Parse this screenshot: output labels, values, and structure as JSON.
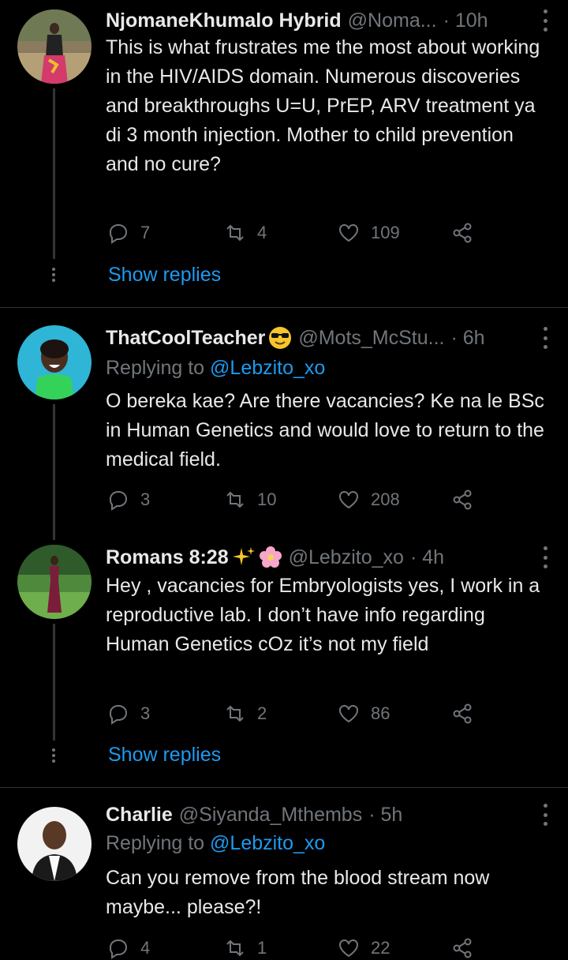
{
  "tweets": [
    {
      "name": "NjomaneKhumalo Hybrid",
      "handle": "@Noma...",
      "time": "· 10h",
      "replying_label": "",
      "replying_to": "",
      "text": "This is what frustrates me the most about working in the HIV/AIDS domain. Numerous discoveries and breakthroughs U=U, PrEP, ARV treatment ya di 3 month injection. Mother to child prevention and no cure?",
      "replies": "7",
      "retweets": "4",
      "likes": "109",
      "show_replies": "Show replies"
    },
    {
      "name": "ThatCoolTeacher",
      "name_emoji": "sunglasses-face",
      "handle": "@Mots_McStu...",
      "time": "· 6h",
      "replying_label": "Replying to",
      "replying_to": "@Lebzito_xo",
      "text": "O bereka kae? Are there vacancies? Ke na le BSc in Human Genetics and would love to return to the medical field.",
      "replies": "3",
      "retweets": "10",
      "likes": "208"
    },
    {
      "name": "Romans 8:28",
      "name_emoji": "sparkles-and-blossom",
      "handle": "@Lebzito_xo",
      "time": "· 4h",
      "text": "Hey , vacancies for Embryologists yes, I work in a reproductive lab. I don’t have info regarding Human Genetics cOz it’s not my field",
      "replies": "3",
      "retweets": "2",
      "likes": "86",
      "show_replies": "Show replies"
    },
    {
      "name": "Charlie",
      "handle": "@Siyanda_Mthembs",
      "time": "· 5h",
      "replying_label": "Replying to",
      "replying_to": "@Lebzito_xo",
      "text": "Can you remove from the blood stream now maybe... please?!",
      "replies": "4",
      "retweets": "1",
      "likes": "22"
    }
  ],
  "colors": {
    "background": "#000000",
    "text": "#e7e9ea",
    "secondary": "#71767b",
    "accent": "#1d9bf0",
    "divider": "#2f3336"
  },
  "icons": [
    "reply-icon",
    "retweet-icon",
    "like-icon",
    "share-icon",
    "more-options-icon"
  ]
}
